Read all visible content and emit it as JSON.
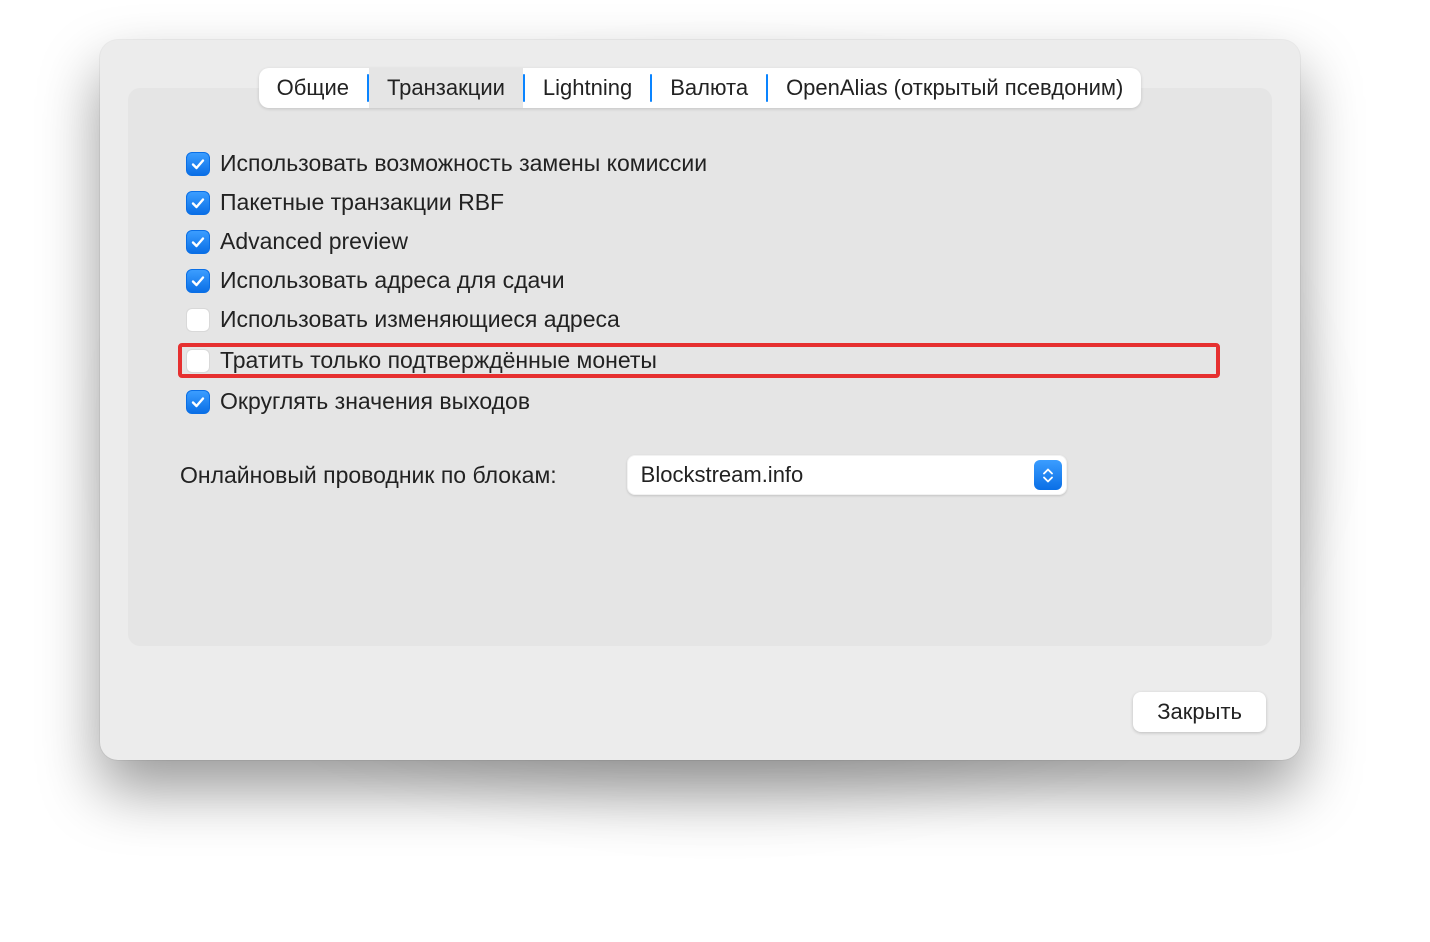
{
  "tabs": {
    "general": "Общие",
    "transactions": "Транзакции",
    "lightning": "Lightning",
    "currency": "Валюта",
    "openalias": "OpenAlias (открытый псевдоним)",
    "selected": "transactions"
  },
  "options": {
    "use_rbf": {
      "label": "Использовать возможность замены комиссии",
      "checked": true
    },
    "batch_rbf": {
      "label": "Пакетные транзакции RBF",
      "checked": true
    },
    "advanced_preview": {
      "label": "Advanced preview",
      "checked": true
    },
    "use_change": {
      "label": "Использовать адреса для сдачи",
      "checked": true
    },
    "use_varying": {
      "label": "Использовать изменяющиеся адреса",
      "checked": false
    },
    "spend_confirmed": {
      "label": "Тратить только подтверждённые монеты",
      "checked": false
    },
    "round_outputs": {
      "label": "Округлять значения выходов",
      "checked": true
    }
  },
  "explorer": {
    "label": "Онлайновый проводник по блокам:",
    "value": "Blockstream.info"
  },
  "buttons": {
    "close": "Закрыть"
  }
}
